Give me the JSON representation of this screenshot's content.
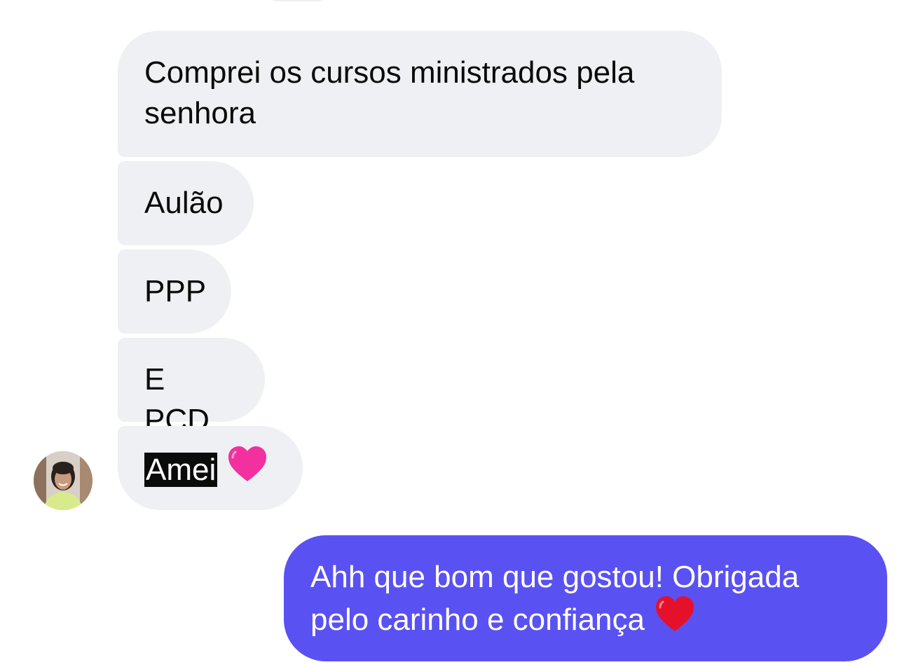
{
  "conversation": {
    "incoming_messages": [
      {
        "text": "Comprei os cursos ministrados pela senhora"
      },
      {
        "text": "Aulão"
      },
      {
        "text": "PPP"
      },
      {
        "text": "E PCD"
      },
      {
        "text": "Amei",
        "emoji": "pink-heart-icon"
      }
    ],
    "outgoing_messages": [
      {
        "text": "Ahh que bom que gostou! Obrigada pelo carinho e confiança",
        "emoji": "red-heart-icon"
      }
    ]
  },
  "colors": {
    "incoming_bubble": "#eff0f3",
    "outgoing_bubble": "#5a51f2",
    "selection_highlight": "#0b0b0b",
    "pink_heart": "#f2309e",
    "red_heart": "#e5112b"
  },
  "icons": {
    "avatar": "contact-avatar"
  }
}
